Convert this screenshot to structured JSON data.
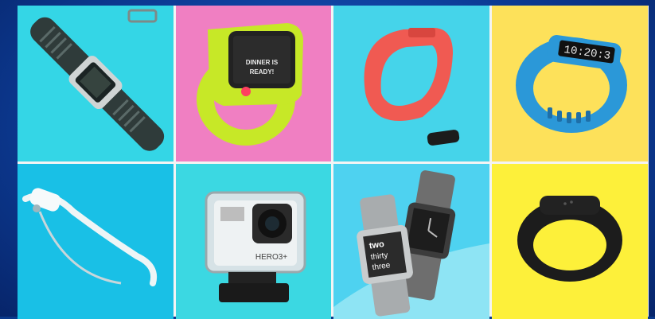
{
  "background_color": "#1048b4",
  "tiles": [
    {
      "id": "tile-1",
      "bg": "#34d6e6",
      "device": "sports-gps-watch",
      "texts": []
    },
    {
      "id": "tile-2",
      "bg": "#f07fc2",
      "device": "kids-smartwatch",
      "texts": [
        "DINNER IS",
        "READY!"
      ]
    },
    {
      "id": "tile-3",
      "bg": "#45d4ea",
      "device": "fitness-band-with-tracker",
      "texts": []
    },
    {
      "id": "tile-4",
      "bg": "#fde15a",
      "device": "fitness-band-display",
      "texts": [
        "10:20:3"
      ]
    },
    {
      "id": "tile-5",
      "bg": "#19c0e6",
      "device": "smart-glasses",
      "texts": []
    },
    {
      "id": "tile-6",
      "bg": "#3bd8e2",
      "device": "action-camera-waterproof-case",
      "texts": [
        "HERO3+"
      ]
    },
    {
      "id": "tile-7",
      "bg": "#4ed2f0",
      "device": "pair-of-smartwatches",
      "texts": [
        "two",
        "thirty",
        "three"
      ]
    },
    {
      "id": "tile-8",
      "bg": "#fdf03a",
      "device": "black-fitness-band",
      "texts": []
    }
  ]
}
